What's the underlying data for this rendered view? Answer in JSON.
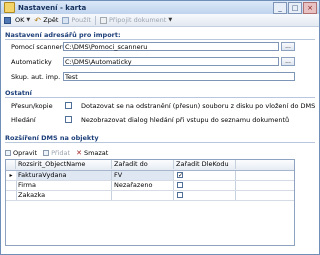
{
  "window": {
    "title": "Nastavení - karta",
    "min": "_",
    "max": "□",
    "close": "×"
  },
  "toolbar": {
    "ok_label": "OK",
    "back_label": "Zpět",
    "apply_label": "Použít",
    "attach_label": "Připojit dokument"
  },
  "import_section": {
    "title": "Nastavení adresářů pro import:",
    "scanner": {
      "label": "Pomocí scanneru",
      "value": "C:\\DMS\\Pomoci_scanneru"
    },
    "auto": {
      "label": "Automaticky",
      "value": "C:\\DMS\\Automaticky"
    },
    "group": {
      "label": "Skup. aut. imp.",
      "value": "Test"
    },
    "browse": "..."
  },
  "other_section": {
    "title": "Ostatní",
    "move": {
      "label": "Přesun/kopie",
      "text": "Dotazovat se na odstranění (přesun) souboru z disku po vložení do DMS",
      "checked": false
    },
    "search": {
      "label": "Hledání",
      "text": "Nezobrazovat dialog hledání při vstupu do seznamu dokumentů",
      "checked": false
    }
  },
  "ext_section": {
    "title": "Rozšíření DMS na objekty",
    "edit_label": "Opravit",
    "add_label": "Přidat",
    "delete_label": "Smazat"
  },
  "grid": {
    "columns": [
      "Rozsirit_ObjectName",
      "Zařadit do",
      "Zařadit DleKodu"
    ],
    "rows": [
      {
        "name": "FakturaVydana",
        "into": "FV",
        "bycode": true,
        "marker": "▸"
      },
      {
        "name": "Firma",
        "into": "Nezařazeno",
        "bycode": false,
        "marker": ""
      },
      {
        "name": "Zakazka",
        "into": "",
        "bycode": false,
        "marker": ""
      }
    ]
  }
}
